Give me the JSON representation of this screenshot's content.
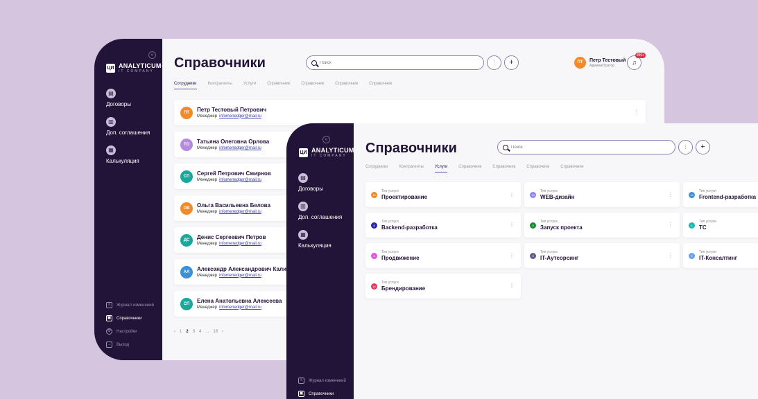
{
  "app": {
    "logo_mark": "ЦИ",
    "logo_name": "ANALYTICUM+",
    "logo_sub": "IT COMPANY",
    "collapse_icon": "«"
  },
  "sidebar": {
    "items": [
      {
        "label": "Договоры",
        "icon": "contract-icon"
      },
      {
        "label": "Доп. соглашения",
        "icon": "agreement-icon"
      },
      {
        "label": "Калькуляция",
        "icon": "calculator-icon"
      }
    ],
    "bottom": [
      {
        "label": "Журнал изменений",
        "icon": "journal-icon"
      },
      {
        "label": "Справочники",
        "icon": "directory-icon"
      },
      {
        "label": "Настройки",
        "icon": "settings-icon"
      },
      {
        "label": "Выход",
        "icon": "logout-icon"
      }
    ]
  },
  "header": {
    "title": "Справочники",
    "search_placeholder": "Поиск",
    "user_initials": "ПТ",
    "user_name": "Петр Тестовый",
    "user_role": "Администратор",
    "notifications": "999+"
  },
  "tabs": [
    "Сотрудники",
    "Контрагенты",
    "Услуги",
    "Справочник",
    "Справочник",
    "Справочник",
    "Справочник"
  ],
  "employees": [
    {
      "initials": "ПТ",
      "name": "Петр Тестовый Петрович",
      "role": "Менеджер",
      "email": "infomenedger@mail.ru",
      "color": "#f28a2a"
    },
    {
      "initials": "ТО",
      "name": "Татьяна Олеговна Орлова",
      "role": "Менеджер",
      "email": "infomenedger@mail.ru",
      "color": "#b48ae0"
    },
    {
      "initials": "СП",
      "name": "Сергей Петрович Смирнов",
      "role": "Менеджер",
      "email": "infomenedger@mail.ru",
      "color": "#1aa79c"
    },
    {
      "initials": "ОВ",
      "name": "Ольга Васильевна Белова",
      "role": "Менеджер",
      "email": "infomenedger@mail.ru",
      "color": "#f28a2a"
    },
    {
      "initials": "ДС",
      "name": "Денис Сергеевич Петров",
      "role": "Менеджер",
      "email": "infomenedger@mail.ru",
      "color": "#1aa79c"
    },
    {
      "initials": "АА",
      "name": "Александр Александрович Калинин",
      "role": "Менеджер",
      "email": "infomenedger@mail.ru",
      "color": "#3d8fd6"
    },
    {
      "initials": "СП",
      "name": "Елена Анатольевна Алексеева",
      "role": "Менеджер",
      "email": "infomenedger@mail.ru",
      "color": "#1aa79c"
    }
  ],
  "pagination": {
    "prev": "‹",
    "pages": [
      "1",
      "2",
      "3",
      "4",
      "...",
      "16"
    ],
    "current": "2",
    "next": "›"
  },
  "services": [
    {
      "label": "Тип услуги",
      "value": "Проектирование",
      "badge": "14",
      "color": "#f28a2a"
    },
    {
      "label": "Тип услуги",
      "value": "WEB-дизайн",
      "badge": "14",
      "color": "#8e86e8"
    },
    {
      "label": "Тип услуги",
      "value": "Frontend-разработка",
      "badge": "14",
      "color": "#3d8fd6"
    },
    {
      "label": "Тип услуги",
      "value": "Backend-разработка",
      "badge": "8",
      "color": "#2a2aa8"
    },
    {
      "label": "Тип услуги",
      "value": "Запуск проекта",
      "badge": "3",
      "color": "#1f8a3a"
    },
    {
      "label": "Тип услуги",
      "value": "ТС",
      "badge": "1",
      "color": "#21b7b7"
    },
    {
      "label": "Тип услуги",
      "value": "Продвижение",
      "badge": "5",
      "color": "#d85ad8"
    },
    {
      "label": "Тип услуги",
      "value": "IT-Аутсорсинг",
      "badge": "3",
      "color": "#6a5a8a"
    },
    {
      "label": "Тип услуги",
      "value": "IT-Консалтинг",
      "badge": "5",
      "color": "#6aa0e8"
    },
    {
      "label": "Тип услуги",
      "value": "Брендирование",
      "badge": "14",
      "color": "#e83a5a"
    }
  ]
}
